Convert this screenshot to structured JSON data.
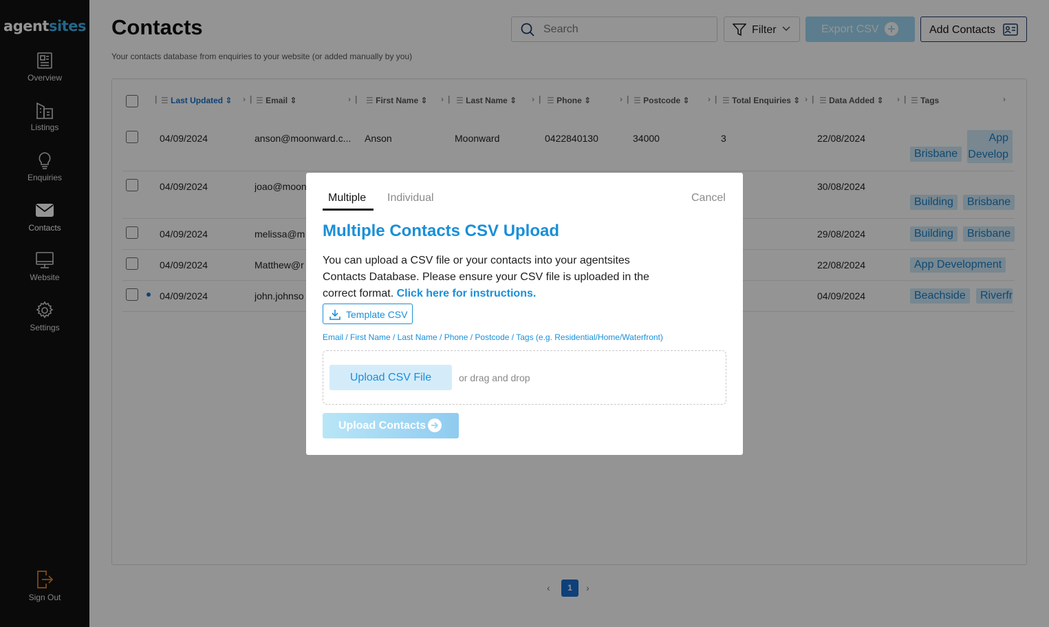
{
  "logo": {
    "part1": "agent",
    "part2": "sites"
  },
  "sidebar": {
    "items": [
      {
        "label": "Overview",
        "icon": "newspaper-icon"
      },
      {
        "label": "Listings",
        "icon": "buildings-icon"
      },
      {
        "label": "Enquiries",
        "icon": "lightbulb-icon"
      },
      {
        "label": "Contacts",
        "icon": "envelope-icon"
      },
      {
        "label": "Website",
        "icon": "monitor-icon"
      },
      {
        "label": "Settings",
        "icon": "gear-icon"
      }
    ],
    "signout": "Sign Out"
  },
  "header": {
    "title": "Contacts",
    "subtitle": "Your contacts database from enquiries to your website (or added manually by you)",
    "search_placeholder": "Search",
    "filter_label": "Filter",
    "export_label": "Export CSV",
    "add_label": "Add Contacts"
  },
  "table": {
    "columns": [
      "Last Updated",
      "Email",
      "First Name",
      "Last Name",
      "Phone",
      "Postcode",
      "Total Enquiries",
      "Data Added",
      "Tags"
    ],
    "rows": [
      {
        "updated": "04/09/2024",
        "email": "anson@moonward.c...",
        "first": "Anson",
        "last": "Moonward",
        "phone": "0422840130",
        "postcode": "34000",
        "enquiries": "3",
        "added": "22/08/2024",
        "tags": [
          "Brisbane",
          "App",
          "Develop"
        ]
      },
      {
        "updated": "04/09/2024",
        "email": "joao@moon",
        "added": "30/08/2024",
        "tags": [
          "Building",
          "Brisbane"
        ]
      },
      {
        "updated": "04/09/2024",
        "email": "melissa@m",
        "added": "29/08/2024",
        "tags": [
          "Building",
          "Brisbane"
        ]
      },
      {
        "updated": "04/09/2024",
        "email": "Matthew@r",
        "added": "22/08/2024",
        "tags": [
          "App Development"
        ]
      },
      {
        "updated": "04/09/2024",
        "email": "john.johnso",
        "added": "04/09/2024",
        "tags": [
          "Beachside",
          "Riverfr"
        ]
      }
    ]
  },
  "pagination": {
    "prev": "‹",
    "page": "1",
    "next": "›"
  },
  "modal": {
    "tab_multiple": "Multiple",
    "tab_individual": "Individual",
    "cancel": "Cancel",
    "title": "Multiple Contacts CSV Upload",
    "desc_line1": "You can upload a CSV file or your contacts into your agentsites",
    "desc_line2": "Contacts Database. Please ensure your CSV file is uploaded in the",
    "desc_line3": "correct format.",
    "desc_link": "Click here for instructions.",
    "template_label": "Template CSV",
    "format_hint": "Email / First Name / Last Name / Phone / Postcode / Tags (e.g. Residential/Home/Waterfront)",
    "upload_file_label": "Upload CSV File",
    "drag_drop": "or drag and drop",
    "upload_contacts_label": "Upload Contacts"
  }
}
